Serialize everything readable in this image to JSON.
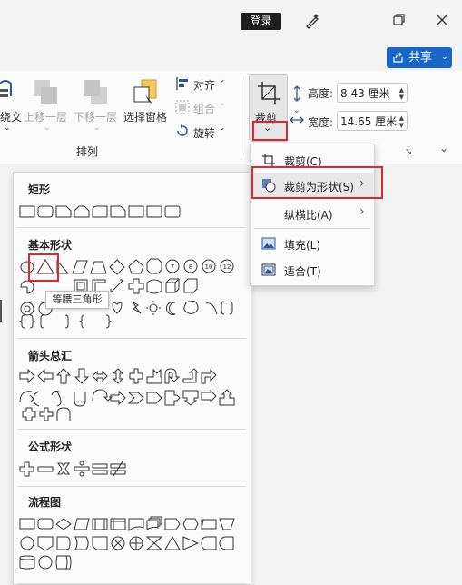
{
  "titlebar": {
    "login_label": "登录",
    "pen_icon": "pen-sparkle-icon",
    "restore_icon": "restore-icon",
    "close_icon": "close-icon"
  },
  "share": {
    "label": "共享",
    "icon": "share-icon"
  },
  "ribbon": {
    "partial_left_label": "绕文",
    "move_up": "上移一层",
    "move_down": "下移一层",
    "selection_pane": "选择窗格",
    "align": "对齐",
    "group": "组合",
    "rotate": "旋转",
    "arrange_group": "排列",
    "crop": "裁剪",
    "height_label": "高度:",
    "height_value": "8.43 厘米",
    "width_label": "宽度:",
    "width_value": "14.65 厘米"
  },
  "crop_menu": {
    "items": [
      {
        "label": "裁剪(C)",
        "icon": "crop-icon"
      },
      {
        "label": "裁剪为形状(S)",
        "icon": "shape-circle-icon",
        "has_submenu": true
      },
      {
        "label": "纵横比(A)",
        "icon": "",
        "has_submenu": true
      },
      {
        "label": "填充(L)",
        "icon": "fill-picture-icon"
      },
      {
        "label": "适合(T)",
        "icon": "fit-picture-icon"
      }
    ]
  },
  "shapes_panel": {
    "sections": [
      {
        "title": "矩形"
      },
      {
        "title": "基本形状"
      },
      {
        "title": "箭头总汇"
      },
      {
        "title": "公式形状"
      },
      {
        "title": "流程图"
      }
    ],
    "tooltip": "等腰三角形",
    "number_shapes": [
      "7",
      "8",
      "10",
      "12"
    ]
  },
  "colors": {
    "accent": "#1a66c7",
    "highlight": "#e0262d",
    "titlebar": "#f3f3f3"
  }
}
